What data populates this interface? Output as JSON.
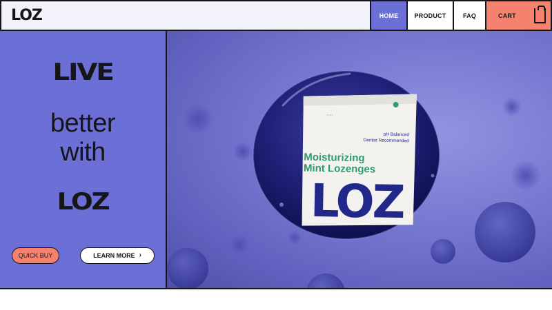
{
  "brand": {
    "logo": "LOZ"
  },
  "nav": {
    "home": "HOME",
    "product": "PRODUCT",
    "faq": "FAQ",
    "cart": "CART"
  },
  "hero": {
    "headline_1": "LIVE",
    "headline_2": "better",
    "headline_3": "with",
    "headline_4": "LOZ",
    "quick_buy": "QUICK BUY",
    "learn_more": "LEARN MORE"
  },
  "package": {
    "tagline_1": "pH Balanced",
    "tagline_2": "Dentist Recommended",
    "name_1": "Moisturizing",
    "name_2": "Mint Lozenges",
    "brand": "LOZ"
  },
  "colors": {
    "accent_purple": "#6b6fd6",
    "accent_coral": "#f4826f",
    "mint_green": "#2e9a6e",
    "package_navy": "#22278a"
  },
  "icons": {
    "cart": "shopping-bag-icon",
    "learn_more": "chevron-right-icon"
  }
}
